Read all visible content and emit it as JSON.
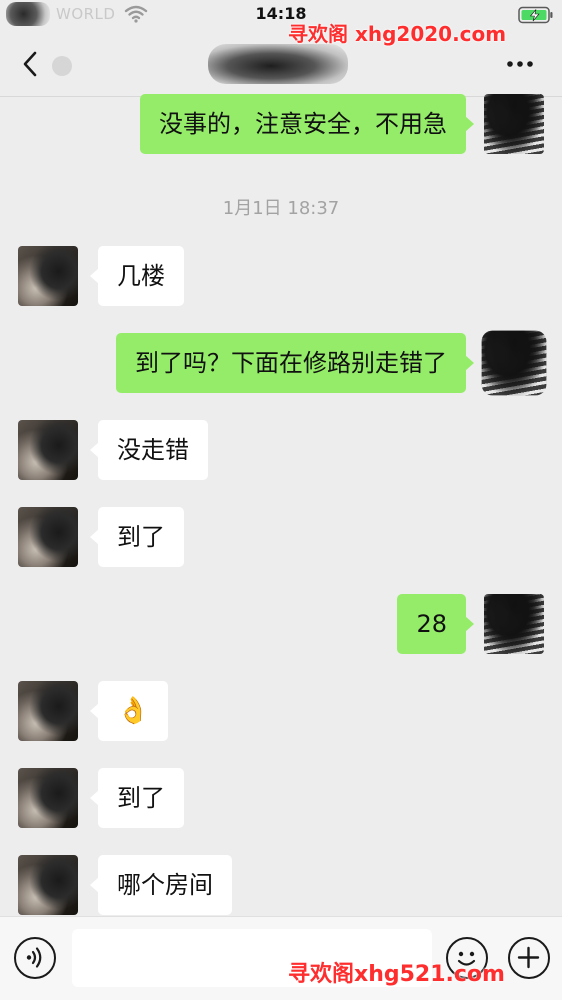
{
  "status_bar": {
    "carrier": "WORLD",
    "time": "14:18"
  },
  "watermarks": {
    "top": "寻欢阁 xhg2020.com",
    "bottom": "寻欢阁xhg521.com"
  },
  "chat": {
    "timestamp": "1月1日 18:37",
    "messages": [
      {
        "direction": "out",
        "text": "没事的，注意安全，不用急"
      },
      {
        "direction": "in",
        "text": "几楼"
      },
      {
        "direction": "out",
        "text": "到了吗？下面在修路别走错了"
      },
      {
        "direction": "in",
        "text": "没走错"
      },
      {
        "direction": "in",
        "text": "到了"
      },
      {
        "direction": "out",
        "text": "28"
      },
      {
        "direction": "in",
        "text": "👌"
      },
      {
        "direction": "in",
        "text": "到了"
      },
      {
        "direction": "in",
        "text": "哪个房间"
      }
    ]
  },
  "icons": {
    "back": "chevron-left-icon",
    "more": "more-dots-icon",
    "voice": "voice-icon",
    "emoji": "emoji-face-icon",
    "plus": "plus-icon",
    "wifi": "wifi-icon",
    "battery": "battery-charging-icon"
  },
  "colors": {
    "background": "#ededed",
    "bubble_out": "#95ec69",
    "bubble_in": "#ffffff",
    "battery": "#4cd964",
    "watermark": "#ff2e2e"
  },
  "input": {
    "value": "",
    "placeholder": ""
  }
}
